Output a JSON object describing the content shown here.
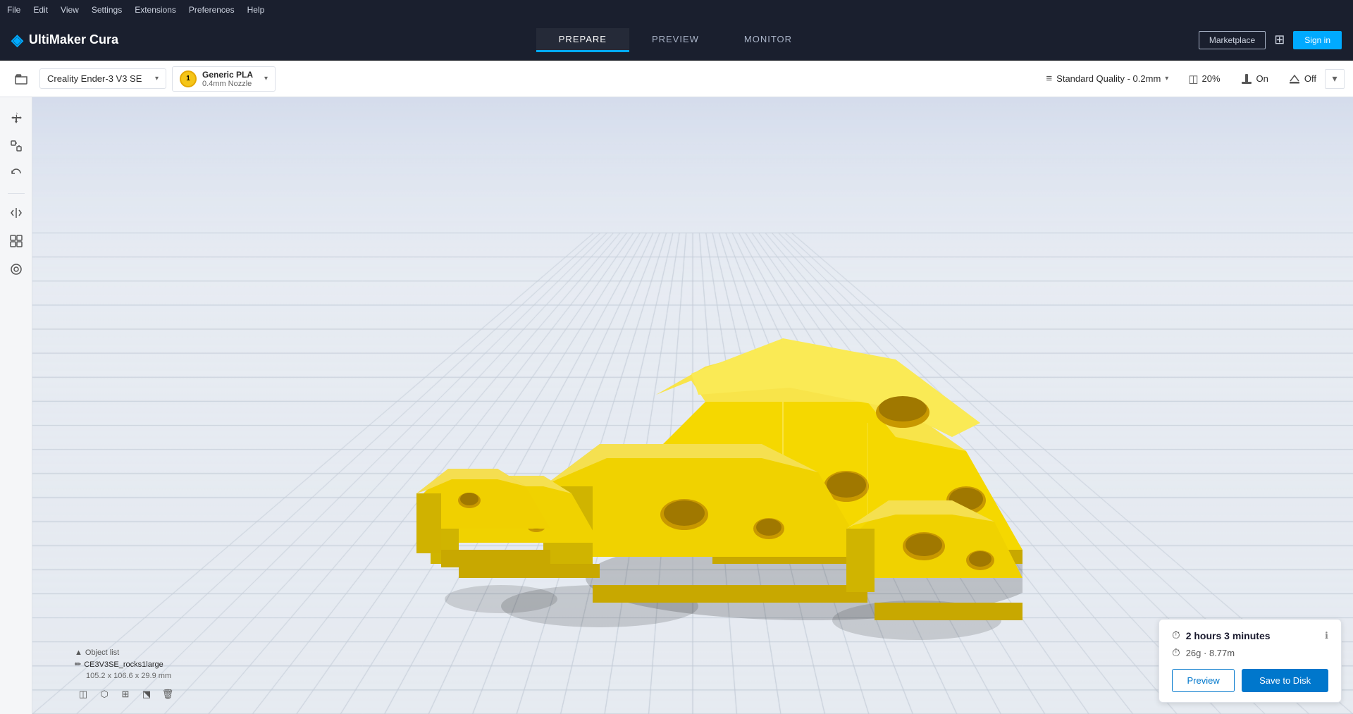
{
  "app": {
    "title": "UltiMaker Cura"
  },
  "menu": {
    "items": [
      "File",
      "Edit",
      "View",
      "Settings",
      "Extensions",
      "Preferences",
      "Help"
    ]
  },
  "nav": {
    "tabs": [
      "PREPARE",
      "PREVIEW",
      "MONITOR"
    ],
    "active": "PREPARE"
  },
  "header": {
    "marketplace_label": "Marketplace",
    "signin_label": "Sign in"
  },
  "toolbar": {
    "printer": {
      "name": "Creality Ender-3 V3 SE"
    },
    "material": {
      "name": "Generic PLA",
      "sub": "0.4mm Nozzle",
      "badge": "1"
    },
    "quality": {
      "label": "Standard Quality - 0.2mm"
    },
    "infill": {
      "value": "20%",
      "label": "20%"
    },
    "support": {
      "label": "On"
    },
    "adhesion": {
      "label": "Off"
    }
  },
  "object": {
    "list_label": "Object list",
    "name": "CE3V3SE_rocks1large",
    "dimensions": "105.2 x 106.6 x 29.9 mm"
  },
  "print_info": {
    "time": "2 hours 3 minutes",
    "material_weight": "26g",
    "material_length": "8.77m",
    "preview_label": "Preview",
    "save_label": "Save to Disk"
  },
  "viewport": {
    "background_color": "#e8ecf2",
    "grid_color": "#c8cdd8"
  }
}
